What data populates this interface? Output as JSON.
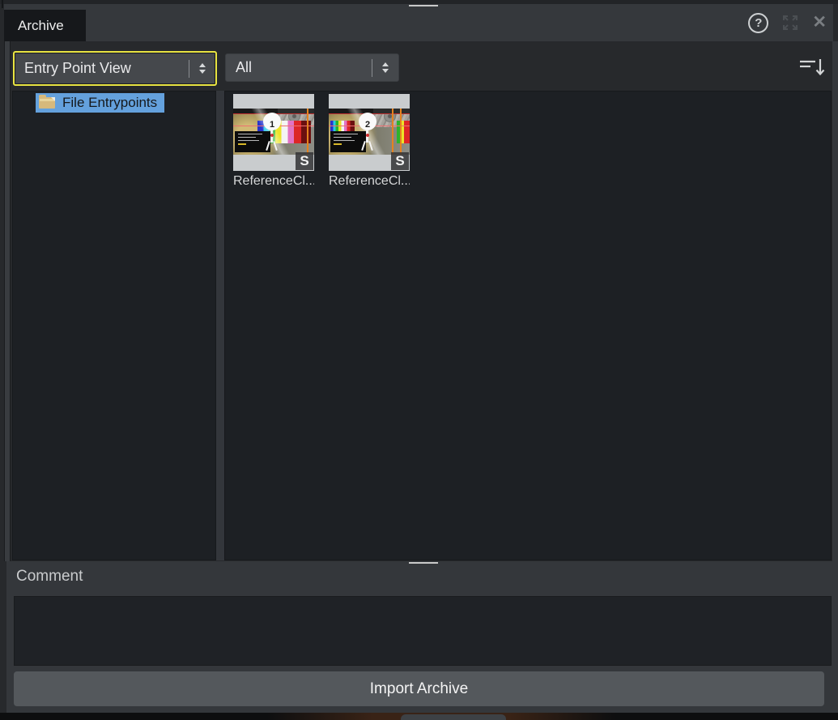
{
  "tab": {
    "label": "Archive"
  },
  "titlebar_icons": {
    "help_glyph": "?",
    "close_glyph": "✕"
  },
  "toolbar": {
    "view_dropdown": {
      "value": "Entry Point View",
      "focused": true
    },
    "filter_dropdown": {
      "value": "All"
    }
  },
  "tree": {
    "items": [
      {
        "label": "File Entrypoints",
        "icon": "folder-icon",
        "selected": true
      }
    ]
  },
  "grid": {
    "items": [
      {
        "label": "ReferenceCl...",
        "badge": "S",
        "overlay_number": "1"
      },
      {
        "label": "ReferenceCl...",
        "badge": "S",
        "overlay_number": "2"
      }
    ]
  },
  "comment": {
    "label": "Comment",
    "value": ""
  },
  "footer": {
    "import_button_label": "Import Archive"
  },
  "colors": {
    "focus_outline": "#e9e442",
    "selection_blue": "#64a1dd",
    "panel_dark": "#1d2024",
    "band_gray": "#34373b",
    "button_gray": "#54585c",
    "accent_orange": "#e6821e"
  }
}
